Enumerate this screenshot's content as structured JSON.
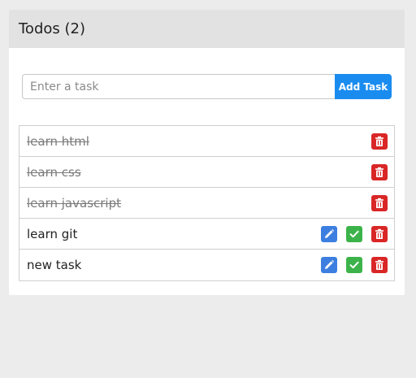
{
  "header": {
    "title": "Todos (2)"
  },
  "form": {
    "placeholder": "Enter a task",
    "value": "",
    "add_label": "Add Task"
  },
  "todos": [
    {
      "text": "learn html",
      "done": true
    },
    {
      "text": "learn css",
      "done": true
    },
    {
      "text": "learn javascript",
      "done": true
    },
    {
      "text": "learn git",
      "done": false
    },
    {
      "text": "new task",
      "done": false
    }
  ],
  "icons": {
    "edit": "pencil-icon",
    "complete": "checkmark-icon",
    "delete": "trash-icon"
  },
  "colors": {
    "accent": "#1a8cf0",
    "edit": "#3d7fe0",
    "complete": "#3cb34a",
    "delete": "#d92626"
  }
}
